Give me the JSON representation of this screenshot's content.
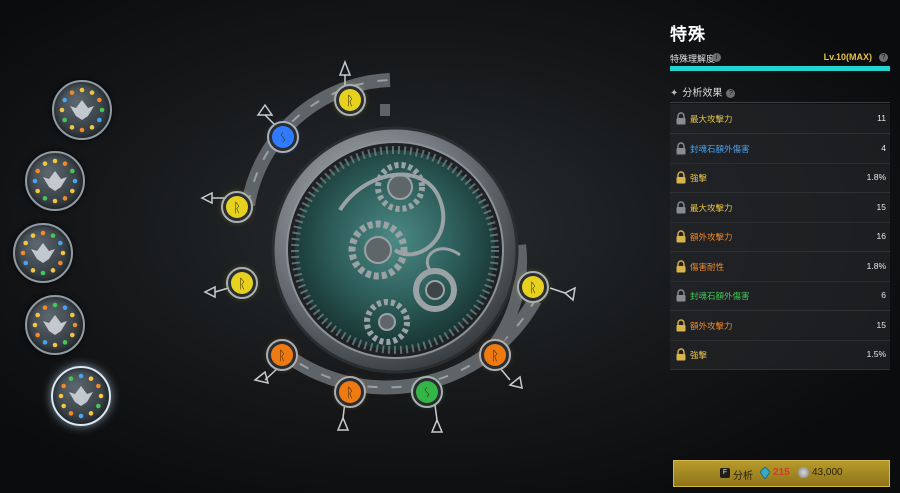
{
  "panel": {
    "title": "特殊",
    "level_label": "特殊理解度",
    "level_value": "Lv.10(MAX)",
    "level_progress": 1.0,
    "effects_header": "分析效果",
    "effects": [
      {
        "name": "最大攻擊力",
        "value": "11",
        "color": "#e8c54a",
        "locked": false
      },
      {
        "name": "封魂石額外傷害",
        "value": "4",
        "color": "#4aa3f0",
        "locked": false
      },
      {
        "name": "強擊",
        "value": "1.8%",
        "color": "#e8c54a",
        "locked": true
      },
      {
        "name": "最大攻擊力",
        "value": "15",
        "color": "#e8c54a",
        "locked": false
      },
      {
        "name": "額外攻擊力",
        "value": "16",
        "color": "#f08a2a",
        "locked": true
      },
      {
        "name": "傷害耐性",
        "value": "1.8%",
        "color": "#f08a2a",
        "locked": true
      },
      {
        "name": "封魂石額外傷害",
        "value": "6",
        "color": "#43c75a",
        "locked": false
      },
      {
        "name": "額外攻擊力",
        "value": "15",
        "color": "#f08a2a",
        "locked": true
      },
      {
        "name": "強擊",
        "value": "1.5%",
        "color": "#e8c54a",
        "locked": true
      }
    ]
  },
  "analyze": {
    "key": "F",
    "label": "分析",
    "crystal_cost": "215",
    "gold_cost": "43,000"
  },
  "medallions": [
    {
      "icon": "winged-crest-icon"
    },
    {
      "icon": "demon-mask-icon"
    },
    {
      "icon": "lotus-icon"
    },
    {
      "icon": "sun-emblem-icon"
    },
    {
      "icon": "star-flower-icon",
      "selected": true
    }
  ],
  "wheel_gems": [
    {
      "color": "#e6d21e",
      "symbol": "ᚱ"
    },
    {
      "color": "#2f7bff",
      "symbol": "ᛊ"
    },
    {
      "color": "#e6d21e",
      "symbol": "ᚱ"
    },
    {
      "color": "#e6d21e",
      "symbol": "ᚱ"
    },
    {
      "color": "#f07a12",
      "symbol": "ᚱ"
    },
    {
      "color": "#f07a12",
      "symbol": "ᚱ"
    },
    {
      "color": "#34b548",
      "symbol": "ᛊ"
    },
    {
      "color": "#f07a12",
      "symbol": "ᚱ"
    },
    {
      "color": "#e6d21e",
      "symbol": "ᚱ"
    }
  ],
  "colors": {
    "accent": "#1fd4d1",
    "gold": "#e6c34a"
  }
}
